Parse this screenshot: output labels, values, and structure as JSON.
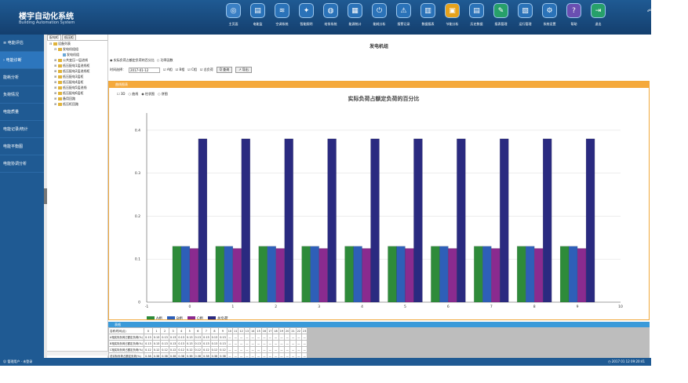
{
  "brand": {
    "title": "楼宇自动化系统",
    "subtitle": "Building Automation System"
  },
  "toolbar": [
    {
      "label": "主页面",
      "icon": "camera-icon"
    },
    {
      "label": "电能监",
      "icon": "monitor-icon"
    },
    {
      "label": "空调系统",
      "icon": "hvac-icon"
    },
    {
      "label": "智能照明",
      "icon": "lighting-icon"
    },
    {
      "label": "给排系统",
      "icon": "water-icon"
    },
    {
      "label": "能源统计",
      "icon": "calendar-icon"
    },
    {
      "label": "能耗分析",
      "icon": "power-icon"
    },
    {
      "label": "报警记录",
      "icon": "alarm-icon"
    },
    {
      "label": "数据报表",
      "icon": "report-icon"
    },
    {
      "label": "节能分析",
      "icon": "energy-icon"
    },
    {
      "label": "历史数据",
      "icon": "history-icon"
    },
    {
      "label": "报表管理",
      "icon": "edit-icon"
    },
    {
      "label": "运行管理",
      "icon": "manage-icon"
    },
    {
      "label": "系统设置",
      "icon": "settings-icon"
    },
    {
      "label": "帮助",
      "icon": "help-icon"
    },
    {
      "label": "退出",
      "icon": "exit-icon"
    }
  ],
  "sidebar": {
    "items": [
      "≡ 电能评估",
      "› 电能诊断",
      "能耗分析",
      "负荷情况",
      "电能质量",
      "电能记录/统计",
      "电能平衡图",
      "电能协调分析"
    ]
  },
  "tree": {
    "tabs": [
      "配电柜",
      "低压柜"
    ],
    "nodes": [
      {
        "text": "设备列表",
        "level": 0,
        "type": "folder",
        "exp": "⊟"
      },
      {
        "text": "发电机组组",
        "level": 1,
        "type": "folder",
        "exp": "⊟"
      },
      {
        "text": "发电机组",
        "level": 2,
        "type": "leaf",
        "exp": ""
      },
      {
        "text": "公共变压一层进线",
        "level": 1,
        "type": "folder",
        "exp": "⊞"
      },
      {
        "text": "低压配电1层进线柜",
        "level": 1,
        "type": "folder",
        "exp": "⊞"
      },
      {
        "text": "低压配电2层进线柜",
        "level": 1,
        "type": "folder",
        "exp": "⊞"
      },
      {
        "text": "低压配电3层柜",
        "level": 1,
        "type": "folder",
        "exp": "⊞"
      },
      {
        "text": "低压配电4层柜",
        "level": 1,
        "type": "folder",
        "exp": "⊞"
      },
      {
        "text": "低压配电5层进线",
        "level": 1,
        "type": "folder",
        "exp": "⊞"
      },
      {
        "text": "低压配电6层柜",
        "level": 1,
        "type": "folder",
        "exp": "⊞"
      },
      {
        "text": "备用回路",
        "level": 1,
        "type": "folder",
        "exp": "⊞"
      },
      {
        "text": "低压柜回路",
        "level": 1,
        "type": "folder",
        "exp": "⊞"
      }
    ]
  },
  "main": {
    "title": "发电机组",
    "options": [
      "◉ 实际负荷占额定负荷的百分比",
      "○ 功率因数"
    ],
    "time_label": "时间选择：",
    "date_value": "2017-01-12",
    "phase_checks": [
      "☑ A相",
      "☑ B相",
      "☑ C相",
      "☑ 总负荷"
    ],
    "query_button": "Q 查询",
    "export_button": "↗ 导出",
    "panel_title": "曲线图表",
    "chart_options": [
      "☐ 3D",
      "○ 曲线",
      "◉ 柱状图",
      "○ 饼图"
    ],
    "table_title": "表格"
  },
  "status": {
    "left": "☺ 管理用户 · 未登录",
    "right": "◷ 2017 01 12 09:20:41"
  },
  "colors": {
    "phase_a": "#2e8b3a",
    "phase_b": "#2e5fb8",
    "phase_c": "#8a2b8f",
    "total": "#2a2a80"
  },
  "chart_data": {
    "type": "bar",
    "title": "实际负荷占额定负荷的百分比",
    "x": [
      0,
      1,
      2,
      3,
      4,
      5,
      6,
      7,
      8,
      9
    ],
    "xlim": [
      -1,
      10
    ],
    "ylim": [
      0,
      0.44
    ],
    "yticks": [
      0,
      0.1,
      0.2,
      0.3,
      0.4
    ],
    "ytick_labels": [
      "0",
      "0.1",
      "0.2",
      "0.3",
      "0.4"
    ],
    "xticks": [
      -1,
      0,
      1,
      2,
      3,
      4,
      5,
      6,
      7,
      8,
      9,
      10
    ],
    "grid": true,
    "legend": "bottom-left",
    "series": [
      {
        "name": "A相",
        "values": [
          0.13,
          0.13,
          0.13,
          0.13,
          0.13,
          0.13,
          0.13,
          0.13,
          0.13,
          0.13
        ]
      },
      {
        "name": "B相",
        "values": [
          0.13,
          0.13,
          0.13,
          0.13,
          0.13,
          0.13,
          0.13,
          0.13,
          0.13,
          0.13
        ]
      },
      {
        "name": "C相",
        "values": [
          0.125,
          0.125,
          0.125,
          0.125,
          0.125,
          0.125,
          0.125,
          0.125,
          0.125,
          0.125
        ]
      },
      {
        "name": "总负荷",
        "values": [
          0.38,
          0.38,
          0.38,
          0.38,
          0.38,
          0.38,
          0.38,
          0.38,
          0.38,
          0.38
        ]
      }
    ]
  },
  "table": {
    "header": [
      "名称\\时间(点)",
      "0",
      "1",
      "2",
      "3",
      "4",
      "5",
      "6",
      "7",
      "8",
      "9",
      "10",
      "11",
      "12",
      "13",
      "14",
      "15",
      "16",
      "17",
      "18",
      "19",
      "20",
      "21",
      "22",
      "23"
    ],
    "rows": [
      [
        "A相实际负荷占额定负荷(%)",
        "0.13",
        "0.13",
        "0.13",
        "0.13",
        "0.13",
        "0.13",
        "0.13",
        "0.13",
        "0.13",
        "0.13",
        "—",
        "—",
        "—",
        "—",
        "—",
        "—",
        "—",
        "—",
        "—",
        "—",
        "—",
        "—",
        "—",
        "—"
      ],
      [
        "B相实际负荷占额定负荷(%)",
        "0.13",
        "0.13",
        "0.13",
        "0.13",
        "0.13",
        "0.13",
        "0.13",
        "0.13",
        "0.13",
        "0.13",
        "—",
        "—",
        "—",
        "—",
        "—",
        "—",
        "—",
        "—",
        "—",
        "—",
        "—",
        "—",
        "—",
        "—"
      ],
      [
        "C相实际负荷占额定负荷(%)",
        "0.12",
        "0.12",
        "0.12",
        "0.12",
        "0.12",
        "0.12",
        "0.12",
        "0.12",
        "0.12",
        "0.12",
        "—",
        "—",
        "—",
        "—",
        "—",
        "—",
        "—",
        "—",
        "—",
        "—",
        "—",
        "—",
        "—",
        "—"
      ],
      [
        "总实际负荷占额定负荷(%)",
        "0.38",
        "0.38",
        "0.38",
        "0.38",
        "0.38",
        "0.38",
        "0.38",
        "0.38",
        "0.38",
        "0.38",
        "—",
        "—",
        "—",
        "—",
        "—",
        "—",
        "—",
        "—",
        "—",
        "—",
        "—",
        "—",
        "—",
        "—"
      ]
    ]
  }
}
